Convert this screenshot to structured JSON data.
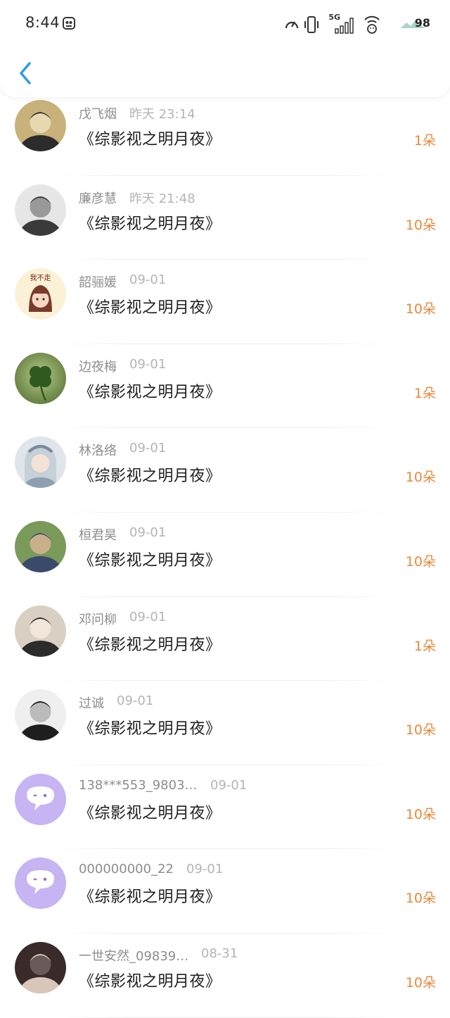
{
  "status_bar": {
    "time": "8:44",
    "battery": "98",
    "network_label": "5G",
    "icons": [
      "speedometer-icon",
      "vibrate-icon",
      "signal-icon",
      "wifi-icon"
    ]
  },
  "header": {
    "back_icon": "chevron-left-icon"
  },
  "colors": {
    "accent": "#2f9ae6",
    "gift": "#e8893a"
  },
  "rows": [
    {
      "name": "戊飞烟",
      "date": "昨天 23:14",
      "title": "《综影视之明月夜》",
      "gift": "1朵",
      "avatar": "photo"
    },
    {
      "name": "廉彦慧",
      "date": "昨天 21:48",
      "title": "《综影视之明月夜》",
      "gift": "10朵",
      "avatar": "photo"
    },
    {
      "name": "韶骊媛",
      "date": "09-01",
      "title": "《综影视之明月夜》",
      "gift": "10朵",
      "avatar": "cartoon",
      "avatar_text": "我不走"
    },
    {
      "name": "边夜梅",
      "date": "09-01",
      "title": "《综影视之明月夜》",
      "gift": "1朵",
      "avatar": "clover"
    },
    {
      "name": "林洛络",
      "date": "09-01",
      "title": "《综影视之明月夜》",
      "gift": "10朵",
      "avatar": "anime"
    },
    {
      "name": "桓君昊",
      "date": "09-01",
      "title": "《综影视之明月夜》",
      "gift": "10朵",
      "avatar": "photo"
    },
    {
      "name": "邓问柳",
      "date": "09-01",
      "title": "《综影视之明月夜》",
      "gift": "1朵",
      "avatar": "photo"
    },
    {
      "name": "过诚",
      "date": "09-01",
      "title": "《综影视之明月夜》",
      "gift": "10朵",
      "avatar": "photo"
    },
    {
      "name": "138***553_9803…",
      "date": "09-01",
      "title": "《综影视之明月夜》",
      "gift": "10朵",
      "avatar": "default"
    },
    {
      "name": "000000000_22",
      "date": "09-01",
      "title": "《综影视之明月夜》",
      "gift": "10朵",
      "avatar": "default"
    },
    {
      "name": "一世安然_09839…",
      "date": "08-31",
      "title": "《综影视之明月夜》",
      "gift": "10朵",
      "avatar": "photo"
    }
  ]
}
